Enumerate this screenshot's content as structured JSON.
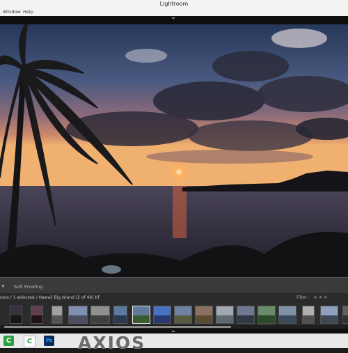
{
  "window": {
    "title": "Lightroom"
  },
  "menu": {
    "items": [
      "Window",
      "Help"
    ]
  },
  "toolbar": {
    "soft_proofing": "Soft Proofing"
  },
  "filmstrip": {
    "info": "otos / 1 selected / Hawaii Big Island (2 of 46).tif",
    "filter_label": "Filter :"
  },
  "taskbar": {
    "apps": [
      {
        "name": "camtasia-icon",
        "label": "C",
        "color": "#2e9e3e"
      },
      {
        "name": "camtasia-recorder-icon",
        "label": "C",
        "color": "#ffffff"
      },
      {
        "name": "photoshop-icon",
        "label": "Ps",
        "color": "#0f2b5c"
      }
    ]
  },
  "watermark": {
    "text": "AXIOS"
  },
  "accent": {
    "selected_border": "#e8e8e8"
  }
}
